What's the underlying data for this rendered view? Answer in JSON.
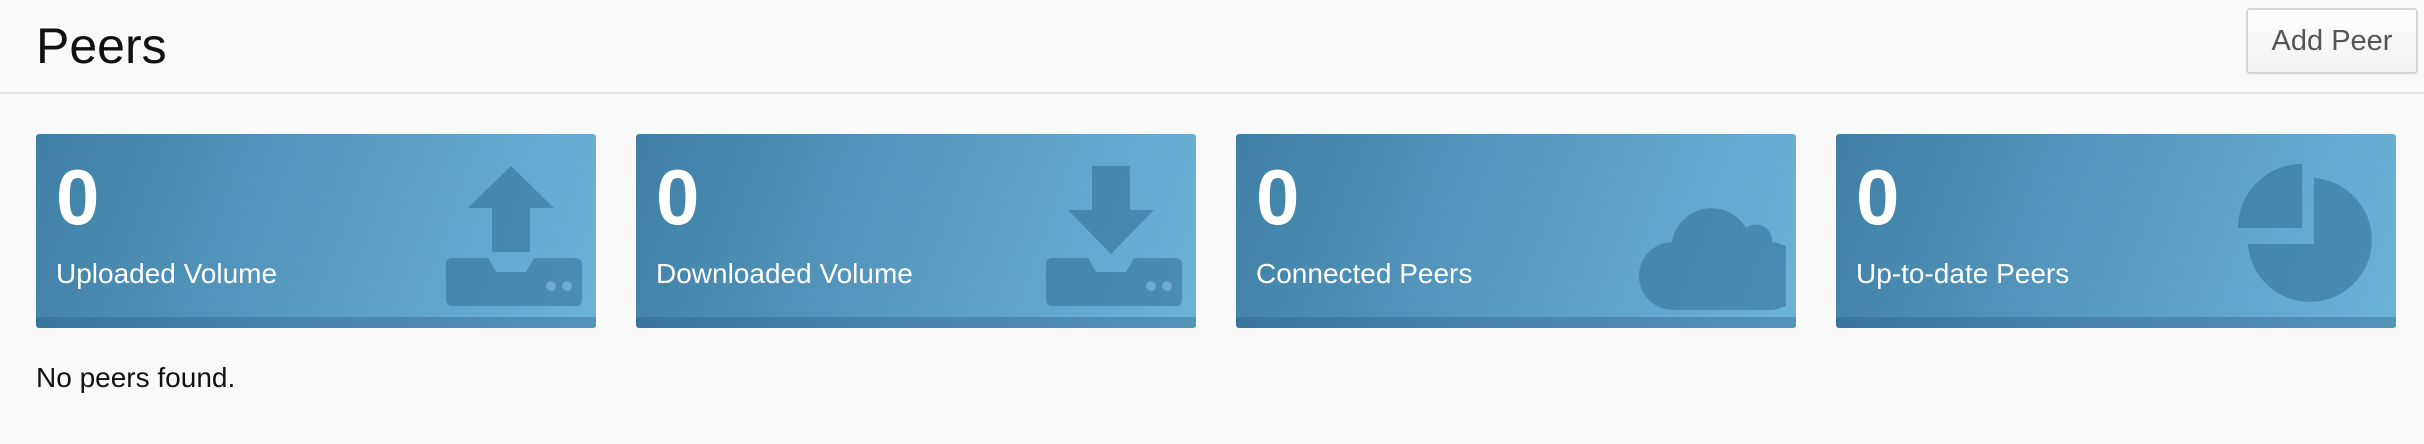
{
  "header": {
    "title": "Peers",
    "add_button_label": "Add Peer"
  },
  "cards": [
    {
      "value": "0",
      "label": "Uploaded Volume",
      "icon": "upload-icon"
    },
    {
      "value": "0",
      "label": "Downloaded Volume",
      "icon": "download-icon"
    },
    {
      "value": "0",
      "label": "Connected Peers",
      "icon": "cloud-icon"
    },
    {
      "value": "0",
      "label": "Up-to-date Peers",
      "icon": "pie-chart-icon"
    }
  ],
  "empty_message": "No peers found.",
  "colors": {
    "card_gradient_start": "#3f7fa6",
    "card_gradient_end": "#6cb3d8",
    "icon_fill": "#2f6f94"
  }
}
